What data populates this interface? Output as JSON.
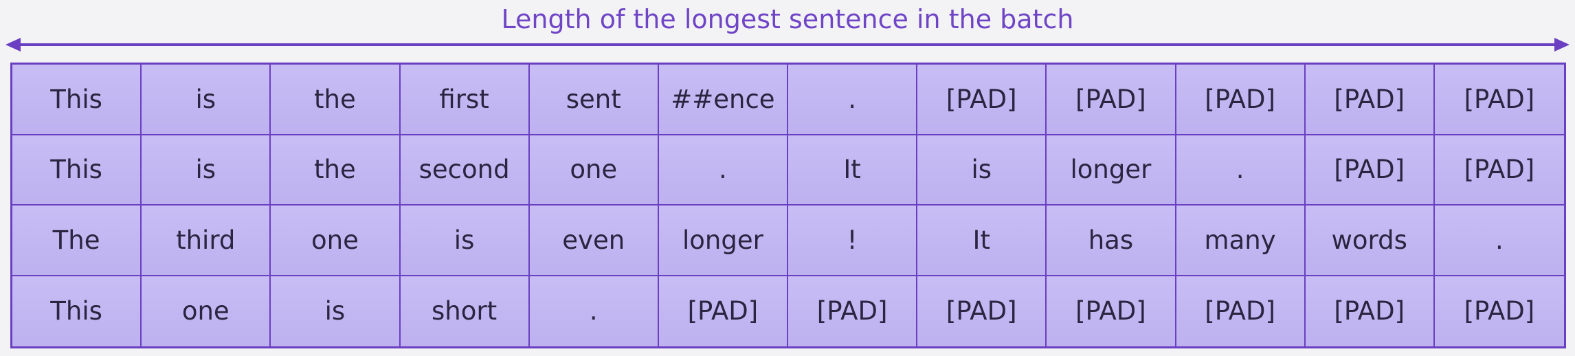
{
  "caption": "Length of the longest sentence in the batch",
  "rows": [
    [
      "This",
      "is",
      "the",
      "first",
      "sent",
      "##ence",
      ".",
      "[PAD]",
      "[PAD]",
      "[PAD]",
      "[PAD]",
      "[PAD]"
    ],
    [
      "This",
      "is",
      "the",
      "second",
      "one",
      ".",
      "It",
      "is",
      "longer",
      ".",
      "[PAD]",
      "[PAD]"
    ],
    [
      "The",
      "third",
      "one",
      "is",
      "even",
      "longer",
      "!",
      "It",
      "has",
      "many",
      "words",
      "."
    ],
    [
      "This",
      "one",
      "is",
      "short",
      ".",
      "[PAD]",
      "[PAD]",
      "[PAD]",
      "[PAD]",
      "[PAD]",
      "[PAD]",
      "[PAD]"
    ]
  ],
  "colors": {
    "accent": "#6a3fc2",
    "cell_fill": "#c3b7f2",
    "caption_text": "#6f45c6"
  }
}
